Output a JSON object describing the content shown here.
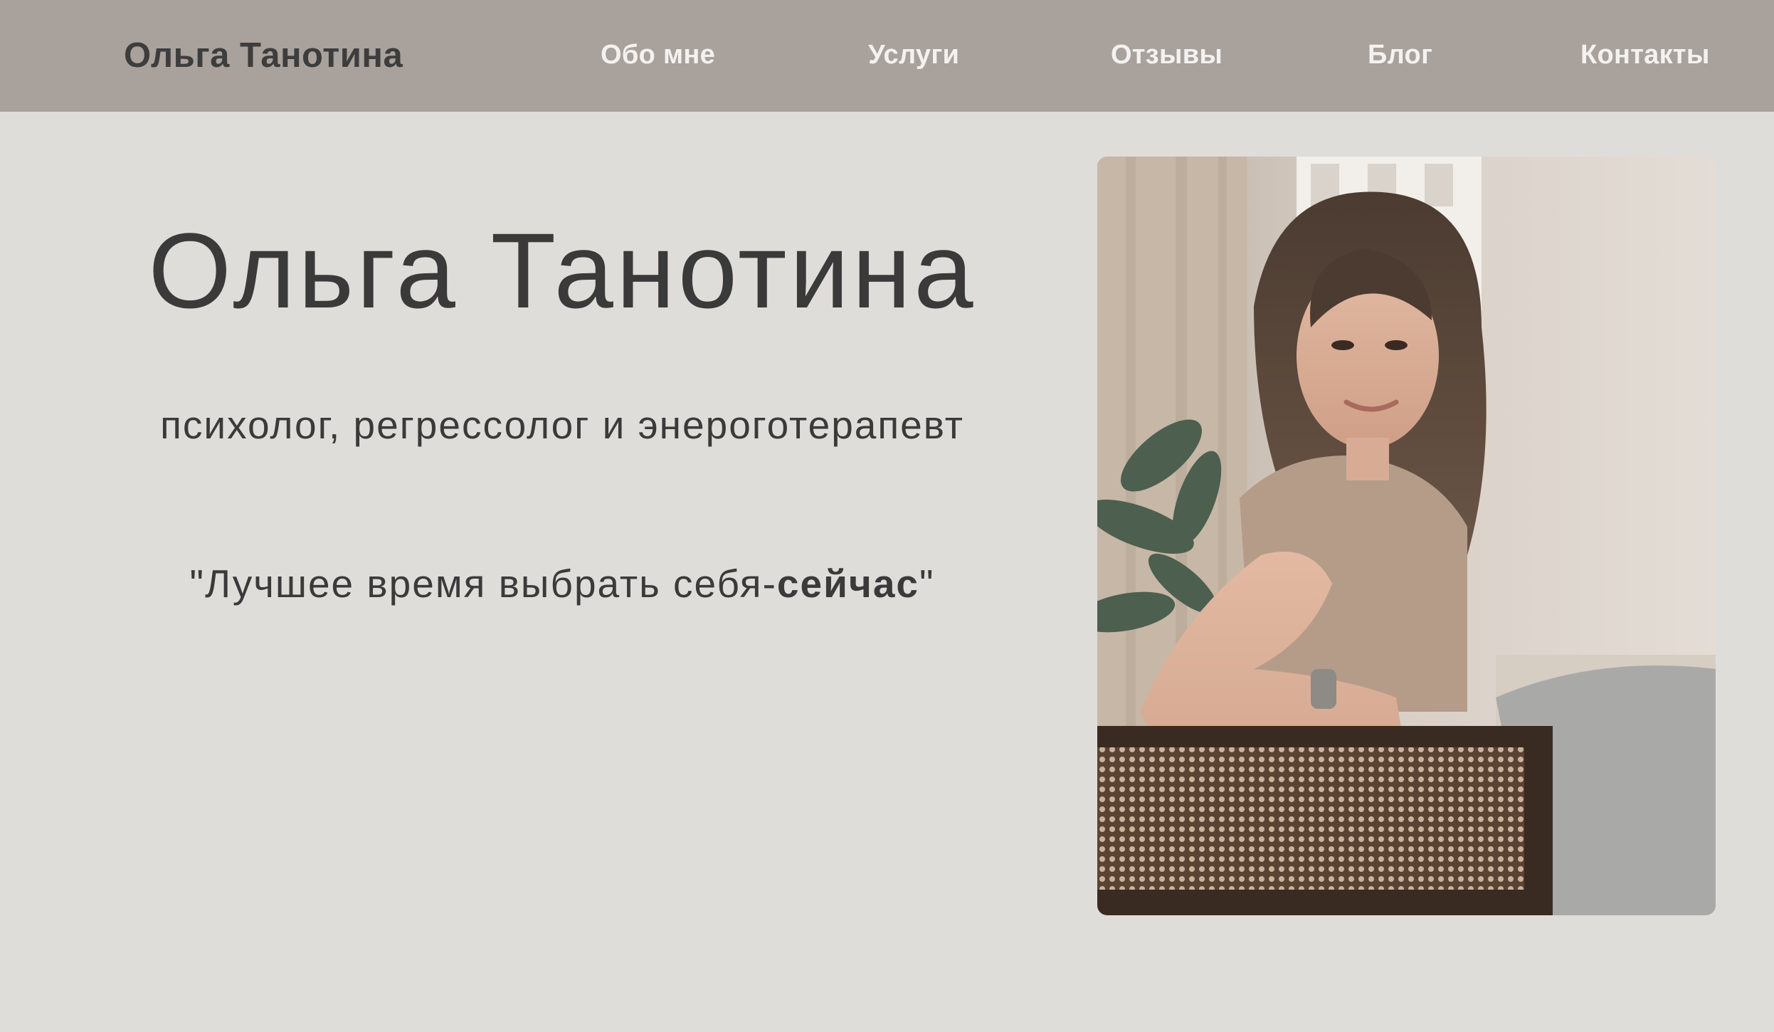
{
  "header": {
    "brand": "Ольга Танотина",
    "nav": [
      {
        "label": "Обо мне"
      },
      {
        "label": "Услуги"
      },
      {
        "label": "Отзывы"
      },
      {
        "label": "Блог"
      },
      {
        "label": "Контакты"
      }
    ]
  },
  "hero": {
    "title": "Ольга Танотина",
    "subtitle": "психолог, регрессолог и энероготерапевт",
    "quote_prefix": "\"Лучшее время выбрать себя-",
    "quote_bold": "сейчас",
    "quote_suffix": "\""
  },
  "colors": {
    "header_bg": "#a9a19c",
    "page_bg": "#dfddd9",
    "text": "#3a3a3a",
    "nav_text": "#f4f2f0"
  }
}
